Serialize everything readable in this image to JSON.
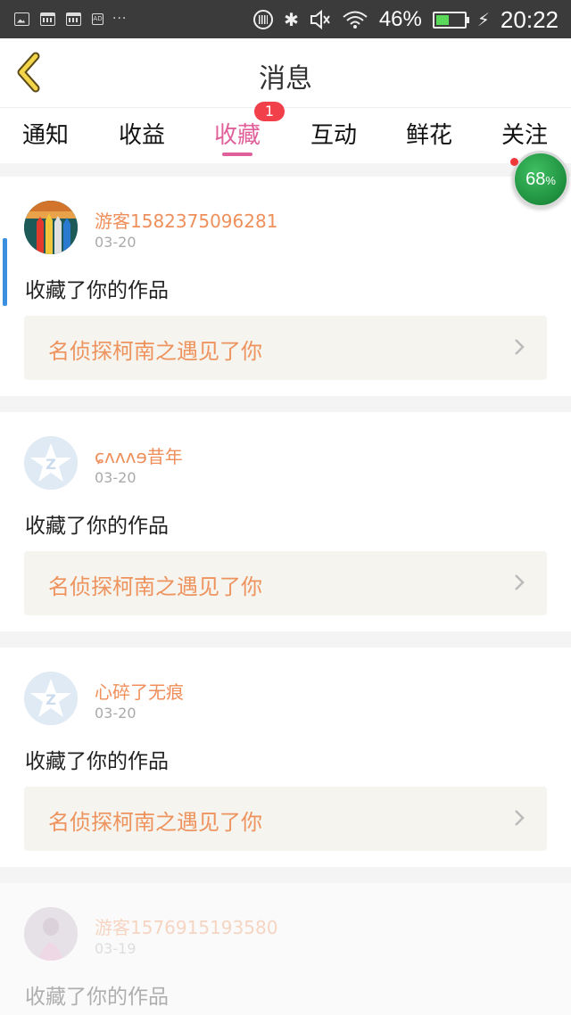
{
  "status_bar": {
    "battery_percent": "46%",
    "battery_level": 0.46,
    "time": "20:22",
    "notification_dots": "···",
    "icons": [
      "image-icon",
      "calendar-icon",
      "calendar-icon",
      "ad-icon",
      "vibrate-icon",
      "bluetooth-icon",
      "mute-icon",
      "wifi-icon",
      "battery-icon",
      "charging-icon"
    ]
  },
  "header": {
    "title": "消息",
    "back_icon": "back-chevron-icon"
  },
  "tabs": {
    "items": [
      {
        "label": "通知"
      },
      {
        "label": "收益"
      },
      {
        "label": "收藏"
      },
      {
        "label": "互动"
      },
      {
        "label": "鲜花"
      },
      {
        "label": "关注"
      }
    ],
    "active_index": 2,
    "badge": "1"
  },
  "progress_widget": {
    "value": "68",
    "unit": "%"
  },
  "messages": [
    {
      "username": "游客1582375096281",
      "date": "03-20",
      "action": "收藏了你的作品",
      "work_title": "名侦探柯南之遇见了你"
    },
    {
      "username": "ɕʌʌʌɘ昔年",
      "date": "03-20",
      "action": "收藏了你的作品",
      "work_title": "名侦探柯南之遇见了你"
    },
    {
      "username": "心碎了无痕",
      "date": "03-20",
      "action": "收藏了你的作品",
      "work_title": "名侦探柯南之遇见了你"
    },
    {
      "username": "游客1576915193580",
      "date": "03-19",
      "action": "收藏了你的作品"
    }
  ],
  "colors": {
    "accent_pink": "#e0609a",
    "badge_red": "#f2404a",
    "username_orange": "#ef8f5b",
    "work_title_orange": "#ee935e",
    "work_box_bg": "#f5f4ee",
    "progress_green": "#1e8f3e",
    "status_bar_bg": "#3b3b3b",
    "indicator_blue": "#3a8fe0"
  }
}
